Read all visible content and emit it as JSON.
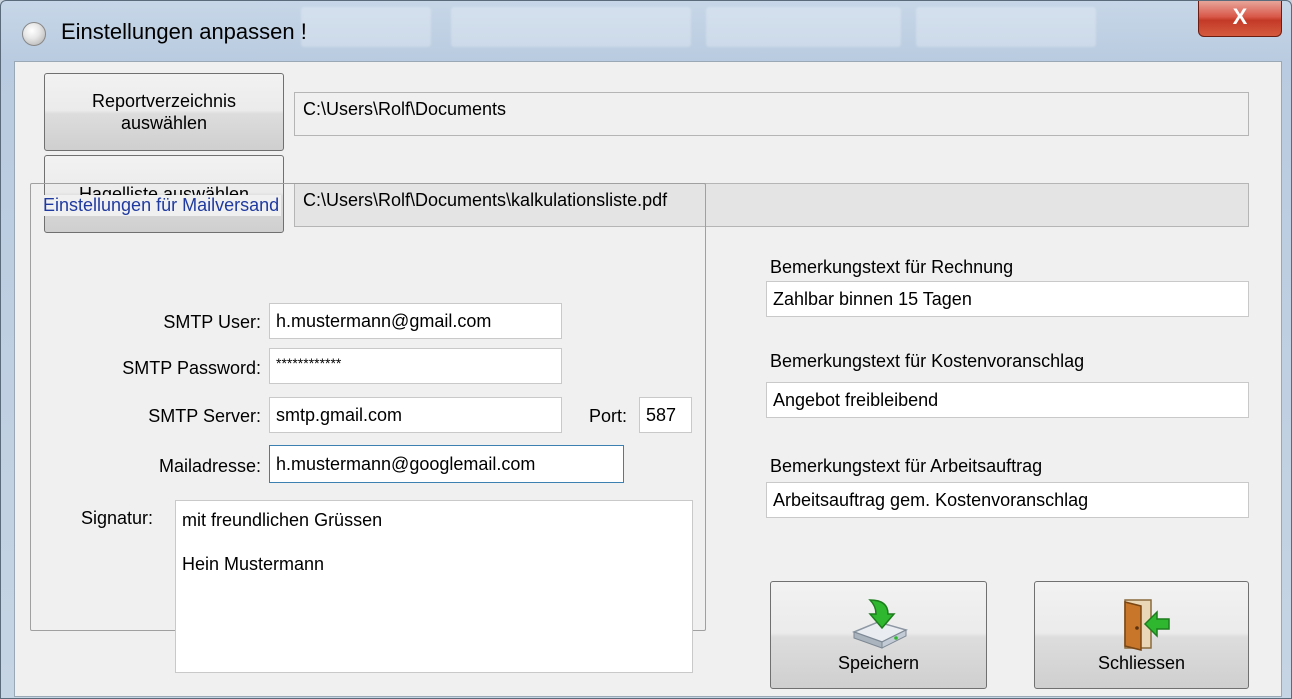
{
  "window": {
    "title": "Einstellungen anpassen !",
    "close_glyph": "X",
    "app_icon": "settings-app-icon"
  },
  "directories": {
    "report_button": "Reportverzeichnis auswählen",
    "report_path": "C:\\Users\\Rolf\\Documents",
    "hail_button": "Hagelliste auswählen",
    "hail_path": "C:\\Users\\Rolf\\Documents\\kalkulationsliste.pdf"
  },
  "mail": {
    "group_title": "Einstellungen für Mailversand",
    "smtp_user_label": "SMTP User:",
    "smtp_user": "h.mustermann@gmail.com",
    "smtp_password_label": "SMTP Password:",
    "smtp_password": "************",
    "smtp_server_label": "SMTP Server:",
    "smtp_server": "smtp.gmail.com",
    "port_label": "Port:",
    "port": "587",
    "mail_address_label": "Mailadresse:",
    "mail_address": "h.mustermann@googlemail.com",
    "signature_label": "Signatur:",
    "signature_lines": [
      "mit freundlichen Grüssen",
      "",
      "Hein Mustermann"
    ]
  },
  "remarks": {
    "invoice_label": "Bemerkungstext für Rechnung",
    "invoice_text": "Zahlbar binnen 15 Tagen",
    "estimate_label": "Bemerkungstext für Kostenvoranschlag",
    "estimate_text": "Angebot freibleibend",
    "workorder_label": "Bemerkungstext für Arbeitsauftrag",
    "workorder_text": "Arbeitsauftrag gem. Kostenvoranschlag"
  },
  "actions": {
    "save_label": "Speichern",
    "save_icon": "save-disk-icon",
    "close_label": "Schliessen",
    "close_icon": "exit-door-icon"
  },
  "colors": {
    "group_title": "#1f3aa0",
    "close_button": "#c43a27",
    "icon_green": "#2fb82f"
  }
}
